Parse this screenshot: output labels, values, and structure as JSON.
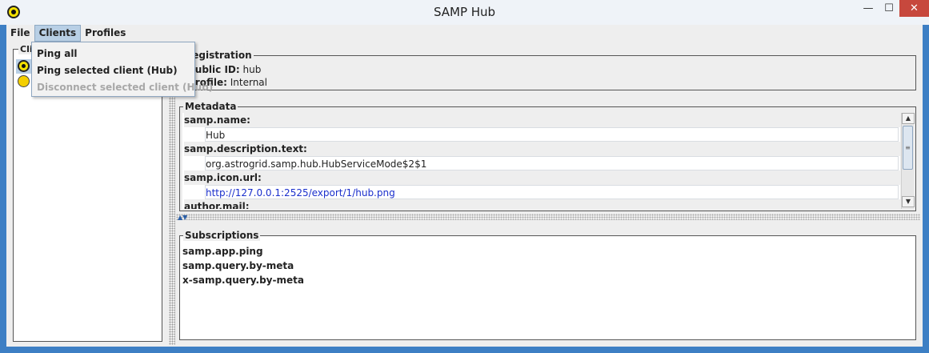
{
  "window": {
    "title": "SAMP Hub",
    "minimize_glyph": "—",
    "maximize_glyph": "☐",
    "close_glyph": "✕"
  },
  "menubar": {
    "items": [
      {
        "label": "File"
      },
      {
        "label": "Clients"
      },
      {
        "label": "Profiles"
      }
    ]
  },
  "clients_menu": {
    "items": [
      {
        "label": "Ping all",
        "enabled": true
      },
      {
        "label": "Ping selected client (Hub)",
        "enabled": true
      },
      {
        "label": "Disconnect selected client (Hub)",
        "enabled": false
      }
    ]
  },
  "clients_panel": {
    "legend": "Clients",
    "clients": [
      {
        "icon": "hub-icon",
        "selected": true
      },
      {
        "icon": "bee-icon",
        "selected": false
      }
    ]
  },
  "registration": {
    "legend": "Registration",
    "public_id_label": "Public ID:",
    "public_id": "hub",
    "profile_label": "Profile:",
    "profile": "Internal"
  },
  "metadata": {
    "legend": "Metadata",
    "entries": [
      {
        "key": "samp.name:",
        "value": "Hub"
      },
      {
        "key": "samp.description.text:",
        "value": "org.astrogrid.samp.hub.HubServiceMode$2$1"
      },
      {
        "key": "samp.icon.url:",
        "value": "http://127.0.0.1:2525/export/1/hub.png"
      },
      {
        "key": "author.mail:",
        "value": ""
      }
    ]
  },
  "subscriptions": {
    "legend": "Subscriptions",
    "items": [
      "samp.app.ping",
      "samp.query.by-meta",
      "x-samp.query.by-meta"
    ]
  },
  "colors": {
    "title_bg": "#eff3f8",
    "border_accent": "#3d7fc4",
    "menu_active": "#b8cfe5",
    "link": "#1a2fcc",
    "close_button": "#c7483d"
  }
}
